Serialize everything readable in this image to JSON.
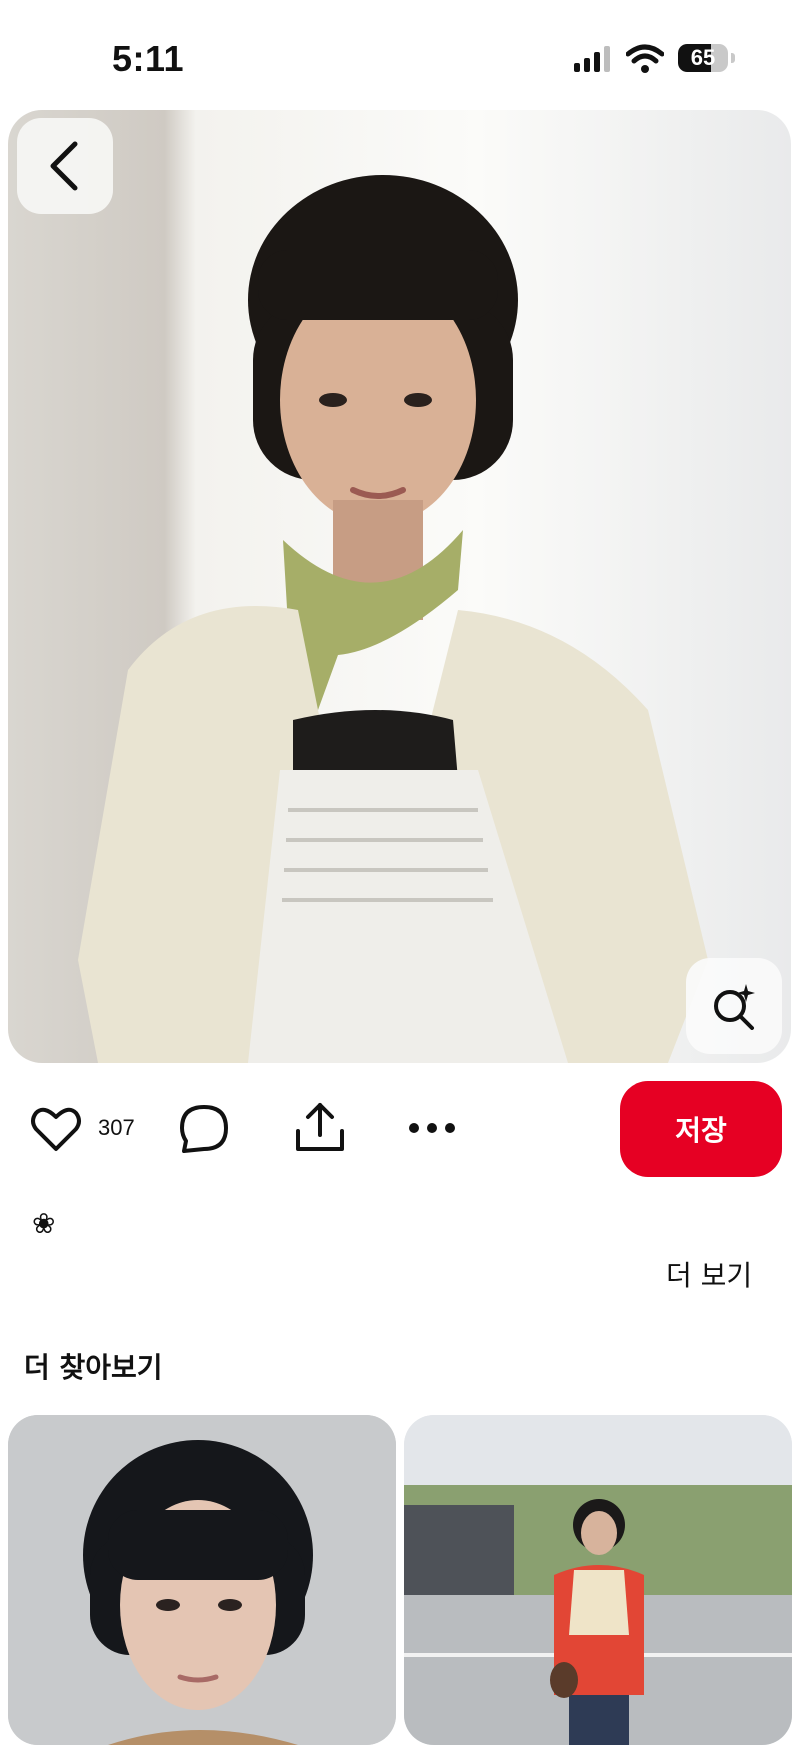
{
  "status_bar": {
    "time": "5:11",
    "battery": "65",
    "battery_level": 0.65,
    "signal_icon": "cellular-signal-icon",
    "wifi_icon": "wifi-icon"
  },
  "pin": {
    "image_description_icon": "photo",
    "back_icon": "chevron-left-icon",
    "visual_search_icon": "lens-sparkle-icon"
  },
  "actions": {
    "like_count": "307",
    "save_label": "저장",
    "icons": [
      "heart-icon",
      "comment-icon",
      "share-icon",
      "more-icon"
    ]
  },
  "description": {
    "text": "❀",
    "more_label": "더 보기"
  },
  "explore": {
    "title": "더 찾아보기"
  },
  "colors": {
    "accent": "#e60023",
    "text": "#111111",
    "background": "#ffffff"
  }
}
